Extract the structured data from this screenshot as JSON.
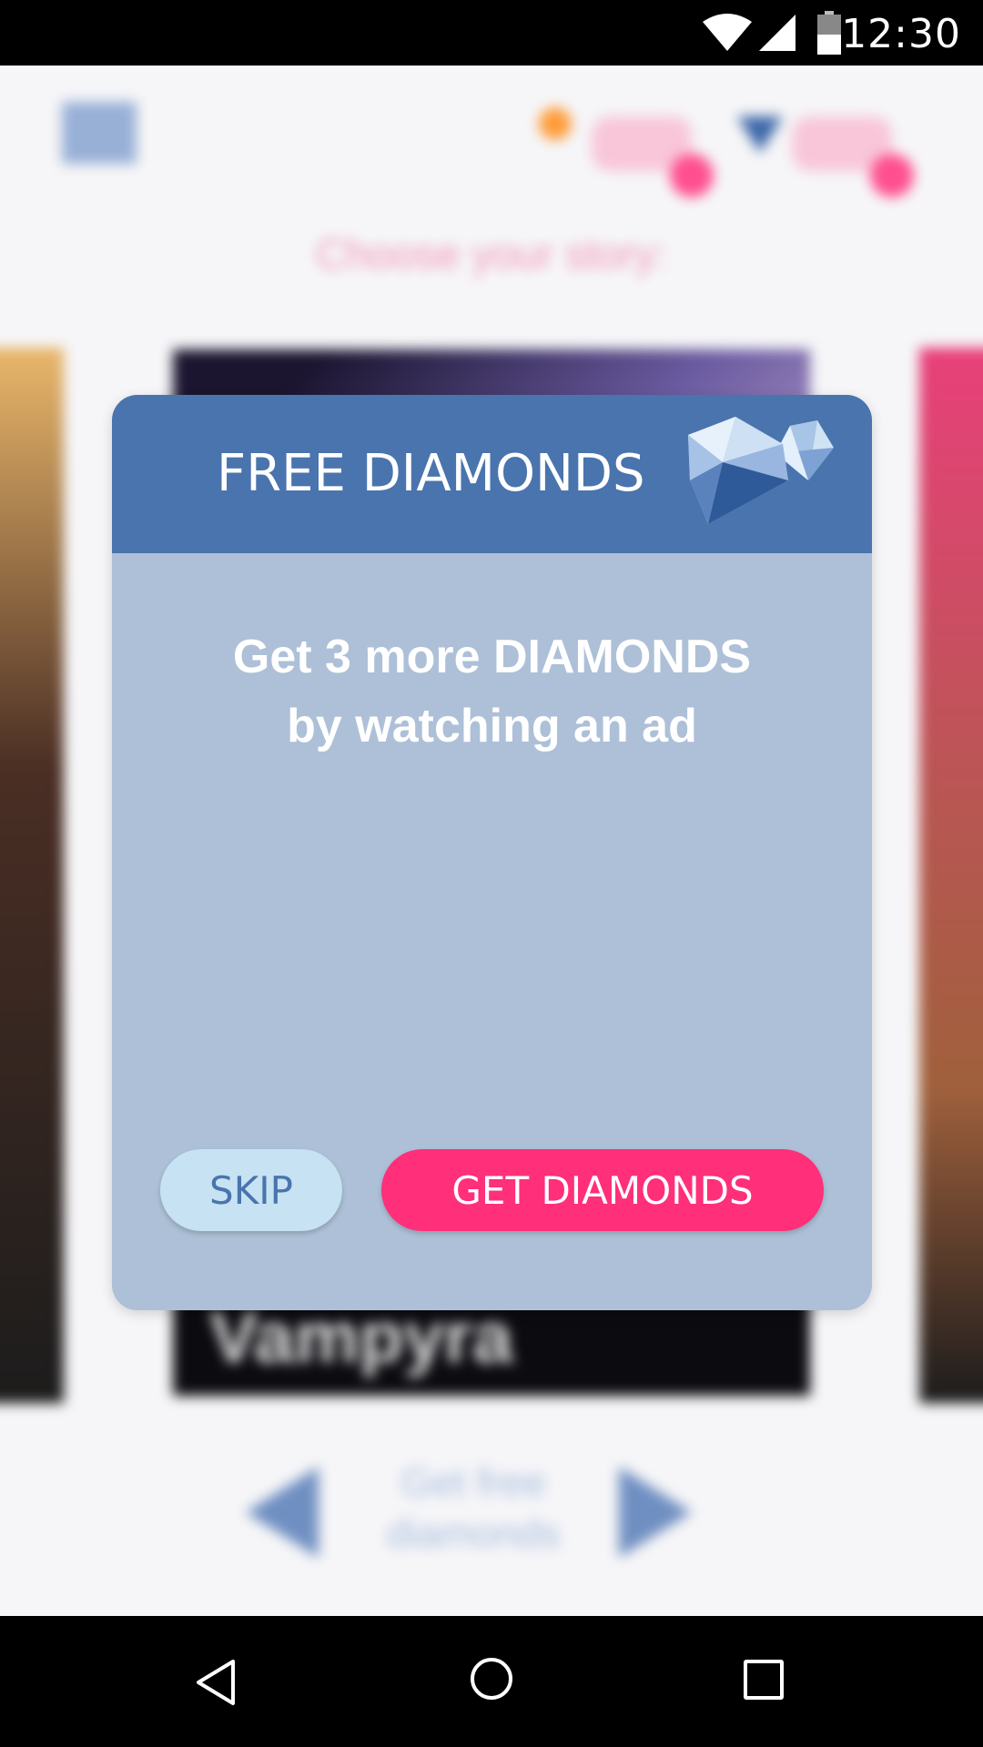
{
  "status_bar": {
    "time": "12:30",
    "icons": [
      "wifi-icon",
      "cell-signal-icon",
      "battery-icon"
    ]
  },
  "background": {
    "header_title": "Choose your story:",
    "story_title": "Vampyra",
    "footer_text": "Get free diamonds"
  },
  "dialog": {
    "title": "FREE DIAMONDS",
    "icon": "diamond-icon",
    "message_line1": "Get 3 more DIAMONDS",
    "message_line2": "by watching an ad",
    "skip_label": "SKIP",
    "get_label": "GET DIAMONDS"
  },
  "colors": {
    "header_blue": "#4a74ad",
    "dialog_body": "#adc0d7",
    "primary_pink": "#ff2f79",
    "skip_bg": "#c6e2f3"
  },
  "nav_bar": {
    "icons": [
      "back-icon",
      "home-icon",
      "recents-icon"
    ]
  }
}
